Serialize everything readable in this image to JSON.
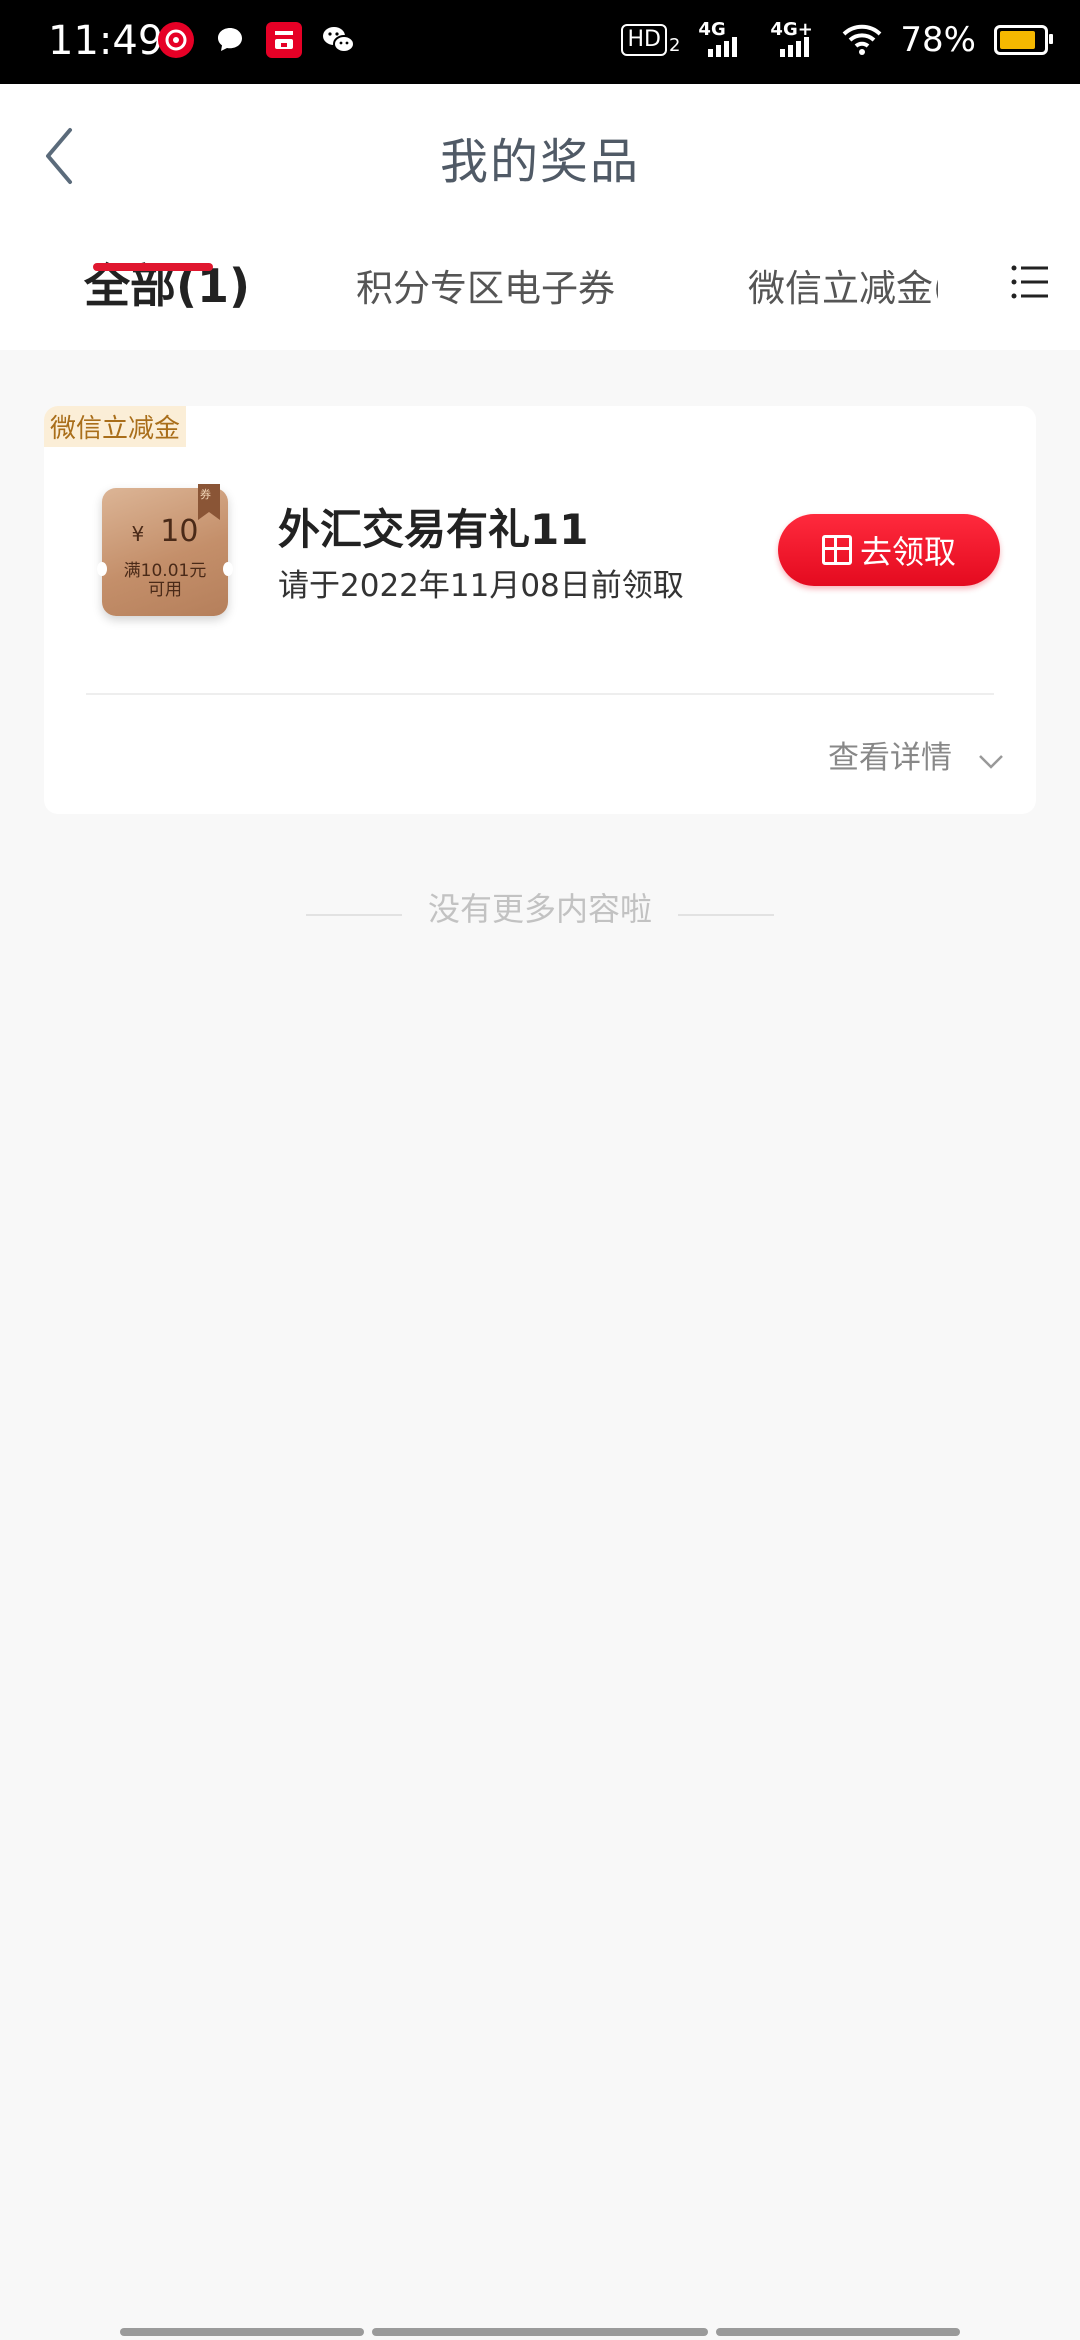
{
  "status_bar": {
    "time": "11:49",
    "app_icons": [
      "netease-music-icon",
      "message-icon",
      "bank-app-icon",
      "wechat-icon"
    ],
    "hd_label": "HD",
    "hd_sub": "2",
    "network1": "4G",
    "network2": "4G+",
    "battery_percent": "78%",
    "battery_level": 0.78
  },
  "header": {
    "title": "我的奖品"
  },
  "tabs": [
    {
      "label": "全部(1)",
      "active": true
    },
    {
      "label": "积分专区电子券",
      "active": false
    },
    {
      "label": "微信立减金(",
      "active": false
    }
  ],
  "prize": {
    "tag": "微信立减金",
    "coupon_currency": "¥",
    "coupon_amount": "10",
    "coupon_condition_line1": "满10.01元",
    "coupon_condition_line2": "可用",
    "coupon_badge": "券",
    "title": "外汇交易有礼11",
    "deadline": "请于2022年11月08日前领取",
    "claim_button": "去领取",
    "detail_link": "查看详情"
  },
  "footer": {
    "no_more_text": "没有更多内容啦"
  },
  "colors": {
    "accent": "#e0172f",
    "tag_text": "#a96e1a",
    "tag_bg": "#fbeed7"
  }
}
